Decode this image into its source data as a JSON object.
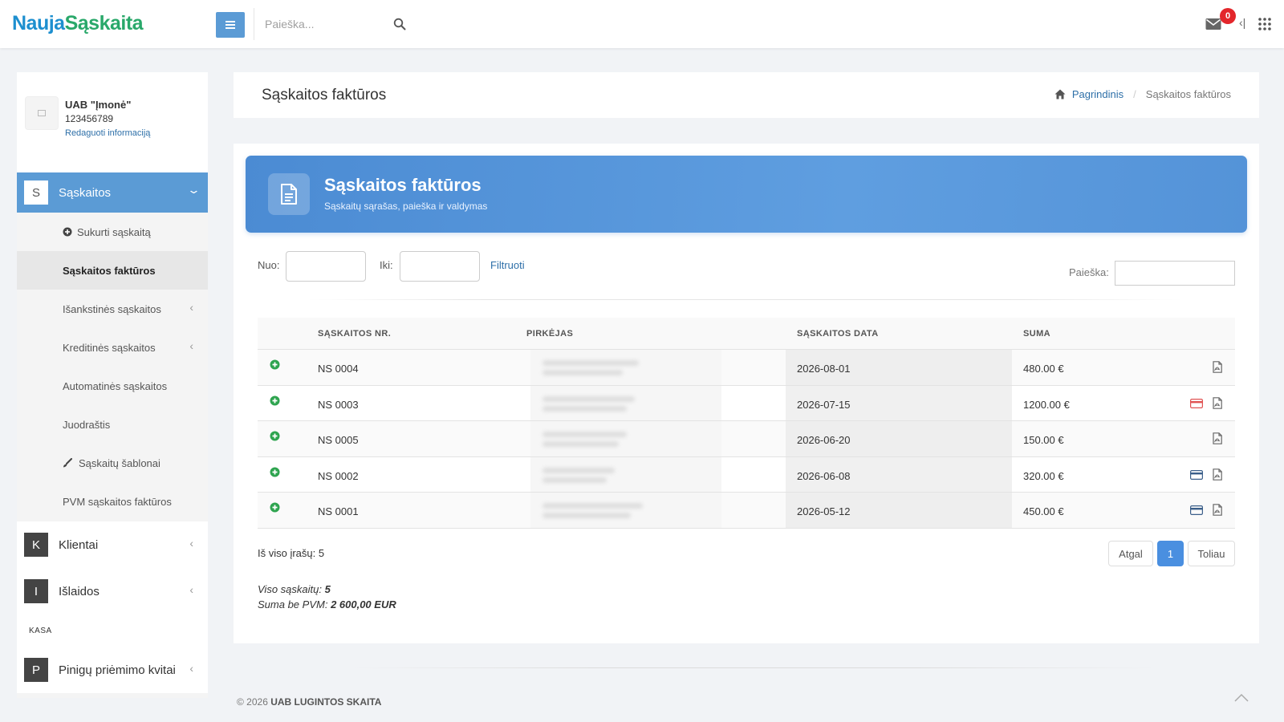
{
  "brand": {
    "part1": "Nauja",
    "part2": "Sąskaita",
    "color1": "#1d8fcf",
    "color2": "#29a86a"
  },
  "topbar": {
    "search_placeholder": "Paieška...",
    "mail_count": "0",
    "icons": [
      "menu-icon",
      "search-icon",
      "mail-icon",
      "collapse-icon",
      "apps-grid-icon"
    ]
  },
  "sidebar": {
    "company_name": "UAB \"Įmonė\"",
    "company_code": "123456789",
    "edit_link": "Redaguoti informaciją",
    "active_section": {
      "letter": "S",
      "label": "Sąskaitos"
    },
    "sub_items": [
      {
        "label": "Sukurti sąskaitą",
        "icon": "plus-circle-icon"
      },
      {
        "label": "Sąskaitos faktūros",
        "selected": true
      },
      {
        "label": "Išankstinės sąskaitos",
        "has_submenu": true
      },
      {
        "label": "Kreditinės sąskaitos",
        "has_submenu": true
      },
      {
        "label": "Automatinės sąskaitos"
      },
      {
        "label": "Juodraštis"
      },
      {
        "label": "Sąskaitų šablonai",
        "icon": "brush-icon"
      },
      {
        "label": "PVM sąskaitos faktūros"
      }
    ],
    "main_items": [
      {
        "letter": "K",
        "label": "Klientai"
      },
      {
        "letter": "I",
        "label": "Išlaidos"
      }
    ],
    "section_label": "KASA",
    "cash_item": {
      "letter": "P",
      "label": "Pinigų priėmimo kvitai"
    },
    "accent_color": "#5b9bd5"
  },
  "header": {
    "title": "Sąskaitos faktūros",
    "breadcrumb_home": "Pagrindinis",
    "breadcrumb_sep": "/",
    "breadcrumb_current": "Sąskaitos faktūros"
  },
  "banner": {
    "title": "Sąskaitos faktūros",
    "subtitle": "Sąskaitų sąrašas, paieška ir valdymas",
    "icon": "document-icon"
  },
  "filters": {
    "from_label": "Nuo:",
    "to_label": "Iki:",
    "filter_link": "Filtruoti",
    "search_label": "Paieška:"
  },
  "table": {
    "columns": [
      "SĄSKAITOS NR.",
      "PIRKĖJAS",
      "SĄSKAITOS DATA",
      "SUMA"
    ],
    "rows": [
      {
        "number": "NS 0004",
        "date": "2026-08-01",
        "amount": "480.00 €",
        "card_icon": "none"
      },
      {
        "number": "NS 0003",
        "date": "2026-07-15",
        "amount": "1200.00 €",
        "card_icon": "red"
      },
      {
        "number": "NS 0005",
        "date": "2026-06-20",
        "amount": "150.00 €",
        "card_icon": "none"
      },
      {
        "number": "NS 0002",
        "date": "2026-06-08",
        "amount": "320.00 €",
        "card_icon": "blue"
      },
      {
        "number": "NS 0001",
        "date": "2026-05-12",
        "amount": "450.00 €",
        "card_icon": "blue"
      }
    ]
  },
  "pagination": {
    "total_label": "Iš viso įrašų: 5",
    "prev": "Atgal",
    "current": "1",
    "next": "Toliau",
    "active_color": "#4a8fe0"
  },
  "summary": {
    "count_label": "Viso sąskaitų:",
    "count_value": "5",
    "sum_label": "Suma be PVM:",
    "sum_value": "2 600,00 EUR"
  },
  "footer": {
    "prefix": "© 2026",
    "company": "UAB LUGINTOS SKAITA"
  }
}
